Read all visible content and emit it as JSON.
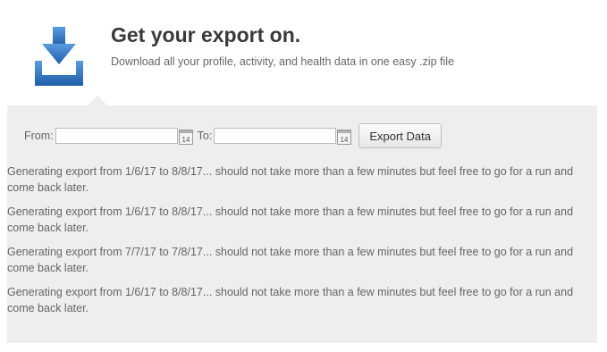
{
  "header": {
    "title": "Get your export on.",
    "subtitle": "Download all your profile, activity, and health data in one easy .zip file",
    "icon": "download-icon",
    "icon_color": "#2f6fb3"
  },
  "form": {
    "from_label": "From:",
    "to_label": "To:",
    "from_value": "",
    "to_value": "",
    "calendar_icon": "calendar-icon",
    "calendar_day": "14",
    "export_button_label": "Export Data"
  },
  "messages": [
    "Generating export from 1/6/17 to 8/8/17... should not take more than a few minutes but feel free to go for a run and come back later.",
    "Generating export from 1/6/17 to 8/8/17... should not take more than a few minutes but feel free to go for a run and come back later.",
    "Generating export from 7/7/17 to 7/8/17... should not take more than a few minutes but feel free to go for a run and come back later.",
    "Generating export from 1/6/17 to 8/8/17... should not take more than a few minutes but feel free to go for a run and come back later."
  ]
}
